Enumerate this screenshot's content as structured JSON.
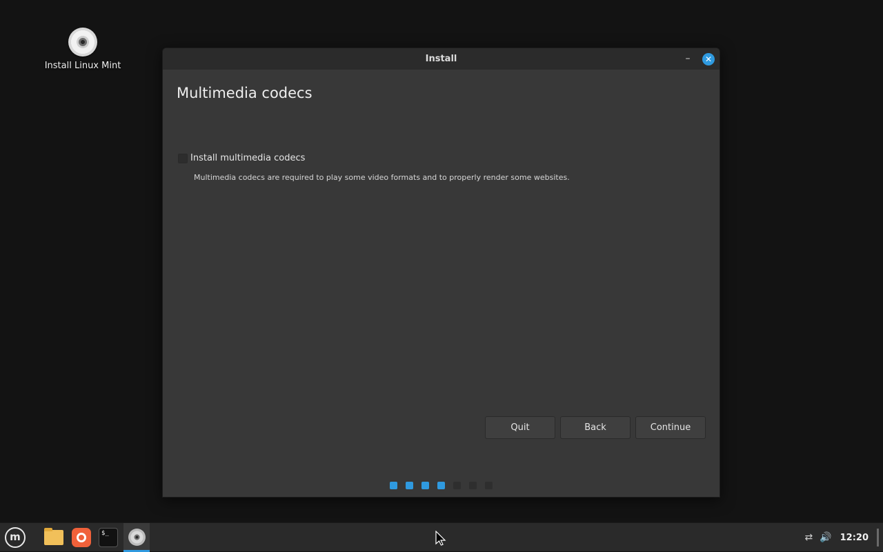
{
  "desktop": {
    "icon_label": "Install Linux Mint"
  },
  "window": {
    "title": "Install",
    "minimize_glyph": "–",
    "close_glyph": "✕",
    "heading": "Multimedia codecs",
    "checkbox": {
      "label": "Install multimedia codecs",
      "checked": false
    },
    "description": "Multimedia codecs are required to play some video formats and to properly render some websites.",
    "buttons": {
      "quit": "Quit",
      "back": "Back",
      "continue": "Continue"
    },
    "progress": {
      "total_steps": 7,
      "completed_steps": 4
    }
  },
  "taskbar": {
    "menu_glyph": "m",
    "terminal_glyph": "$_",
    "network_glyph": "⇄",
    "volume_glyph": "🔊",
    "clock": "12:20",
    "apps": [
      "menu-icon",
      "files-icon",
      "firefox-icon",
      "terminal-icon",
      "installer-icon"
    ]
  },
  "colors": {
    "accent": "#2f9ae0",
    "window_bg": "#383838",
    "titlebar_bg": "#2b2b2b",
    "desktop_bg": "#131313",
    "taskbar_bg": "#2a2a2a"
  }
}
